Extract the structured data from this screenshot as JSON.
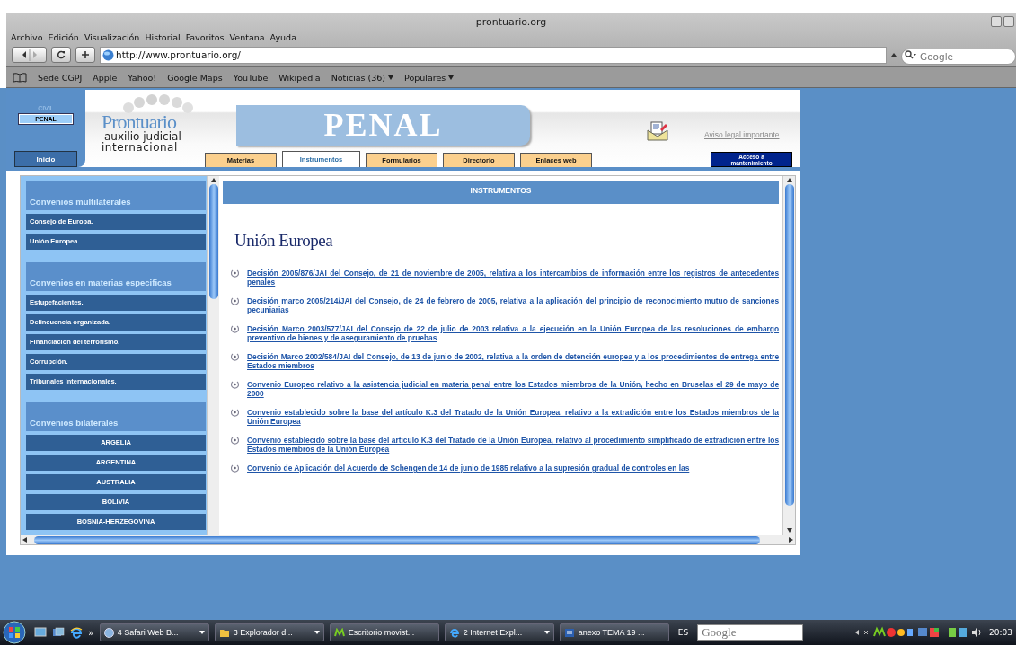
{
  "window": {
    "title": "prontuario.org"
  },
  "menu": [
    "Archivo",
    "Edición",
    "Visualización",
    "Historial",
    "Favoritos",
    "Ventana",
    "Ayuda"
  ],
  "toolbar": {
    "url": "http://www.prontuario.org/",
    "search_placeholder": "Google"
  },
  "bookmarks": [
    {
      "label": "Sede CGPJ",
      "dropdown": false
    },
    {
      "label": "Apple",
      "dropdown": false
    },
    {
      "label": "Yahoo!",
      "dropdown": false
    },
    {
      "label": "Google Maps",
      "dropdown": false
    },
    {
      "label": "YouTube",
      "dropdown": false
    },
    {
      "label": "Wikipedia",
      "dropdown": false
    },
    {
      "label": "Noticias (36)",
      "dropdown": true
    },
    {
      "label": "Populares",
      "dropdown": true
    }
  ],
  "page": {
    "sections": [
      {
        "label": "CIVIL",
        "selected": false
      },
      {
        "label": "PENAL",
        "selected": true
      }
    ],
    "home_tab": "Inicio",
    "logo": {
      "title": "Prontuario",
      "subtitle_1": "auxilio judicial",
      "subtitle_2": "internacional"
    },
    "banner": "PENAL",
    "legal_link": "Aviso legal importante",
    "tabs": [
      {
        "label": "Materias",
        "selected": false
      },
      {
        "label": "Instrumentos",
        "selected": true
      },
      {
        "label": "Formularios",
        "selected": false
      },
      {
        "label": "Directorio",
        "selected": false
      },
      {
        "label": "Enlaces web",
        "selected": false
      }
    ],
    "maintenance_button": "Acceso a mantenimiento",
    "sidebar": [
      {
        "heading": "Convenios multilaterales",
        "kind": "topics",
        "items": [
          "Consejo de Europa.",
          "Unión Europea."
        ]
      },
      {
        "heading": "Convenios en materias especificas",
        "kind": "topics",
        "items": [
          "Estupefacientes.",
          "Delincuencia organizada.",
          "Financiación del terrorismo.",
          "Corrupción.",
          "Tribunales Internacionales."
        ]
      },
      {
        "heading": "Convenios bilaterales",
        "kind": "countries",
        "items": [
          "ARGELIA",
          "ARGENTINA",
          "AUSTRALIA",
          "BOLIVIA",
          "BOSNIA-HERZEGOVINA"
        ]
      }
    ],
    "content": {
      "header": "INSTRUMENTOS",
      "heading": "Unión Europea",
      "links": [
        "Decisión 2005/876/JAI del Consejo, de 21 de noviembre de 2005, relativa a los intercambios de información entre los registros de antecedentes penales",
        "Decisión marco 2005/214/JAI del Consejo, de 24 de febrero de 2005, relativa a la aplicación del principio de reconocimiento mutuo de sanciones pecuniarias",
        "Decisión Marco 2003/577/JAI del Consejo de 22 de julio de 2003 relativa a la ejecución en la Unión Europea de las resoluciones de embargo preventivo de bienes y de aseguramiento de pruebas",
        "Decisión Marco 2002/584/JAI del Consejo, de 13 de junio de 2002, relativa a la orden de detención europea y a los procedimientos de entrega entre Estados miembros",
        "Convenio Europeo relativo a la asistencia judicial en materia penal entre los Estados miembros de la Unión, hecho en Bruselas el 29 de mayo de 2000",
        "Convenio establecido sobre la base del artículo K.3 del Tratado de la Unión Europea, relativo a la extradición entre los Estados miembros de la Unión Europea",
        "Convenio establecido sobre la base del artículo K.3 del Tratado de la Unión Europea, relativo al procedimiento simplificado de extradición entre los Estados miembros de la Unión Europea",
        "Convenio de Aplicación del Acuerdo de Schengen de 14 de junio de 1985 relativo a la supresión gradual de controles en las"
      ]
    }
  },
  "taskbar": {
    "more": "»",
    "items": [
      {
        "label": "4 Safari Web B...",
        "kind": "globe",
        "grouped": true
      },
      {
        "label": "3 Explorador d...",
        "kind": "folder",
        "grouped": true
      },
      {
        "label": "Escritorio movist...",
        "kind": "mark",
        "grouped": false
      },
      {
        "label": "2 Internet Expl...",
        "kind": "browser",
        "grouped": true
      },
      {
        "label": "anexo TEMA 19 ...",
        "kind": "document",
        "grouped": false
      }
    ],
    "language": "ES",
    "search_placeholder": "Google",
    "clock": "20:03"
  }
}
